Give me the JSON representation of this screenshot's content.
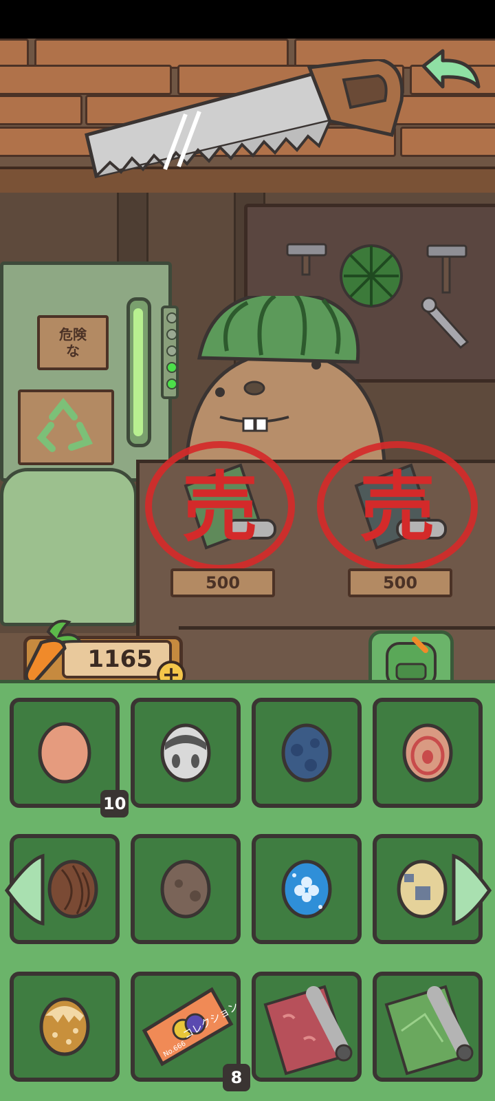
{
  "scene": {
    "danger_sign_text": "危険\nな",
    "back_button_icon": "back-arrow-icon",
    "shop_items": [
      {
        "icon": "wallpaper-roll-icon",
        "sold_mark": "売",
        "price": "500"
      },
      {
        "icon": "wallpaper-roll-icon",
        "sold_mark": "売",
        "price": "500"
      }
    ]
  },
  "currency": {
    "icon": "carrot-icon",
    "value": "1165",
    "add_label": "+"
  },
  "inventory": {
    "tab_icon": "backpack-icon",
    "prev_icon": "chevron-left-icon",
    "next_icon": "chevron-right-icon",
    "slots": [
      {
        "item": "plain-egg",
        "count": "10"
      },
      {
        "item": "spotted-white-egg",
        "count": ""
      },
      {
        "item": "dark-blue-egg",
        "count": ""
      },
      {
        "item": "swirl-egg",
        "count": ""
      },
      {
        "item": "wood-egg",
        "count": ""
      },
      {
        "item": "brown-egg",
        "count": ""
      },
      {
        "item": "clover-blue-egg",
        "count": ""
      },
      {
        "item": "patched-egg",
        "count": ""
      },
      {
        "item": "golden-dotted-egg",
        "count": ""
      },
      {
        "item": "collection-ticket",
        "count": "8",
        "ticket_text": "コレクション",
        "ticket_number": "No.666"
      },
      {
        "item": "red-wallpaper-roll",
        "count": ""
      },
      {
        "item": "green-wallpaper-roll",
        "count": ""
      }
    ]
  },
  "colors": {
    "panel": "#6bb46a",
    "slot": "#3f7d41",
    "sold_stamp": "#d42a2a",
    "outline": "#3a3432"
  }
}
